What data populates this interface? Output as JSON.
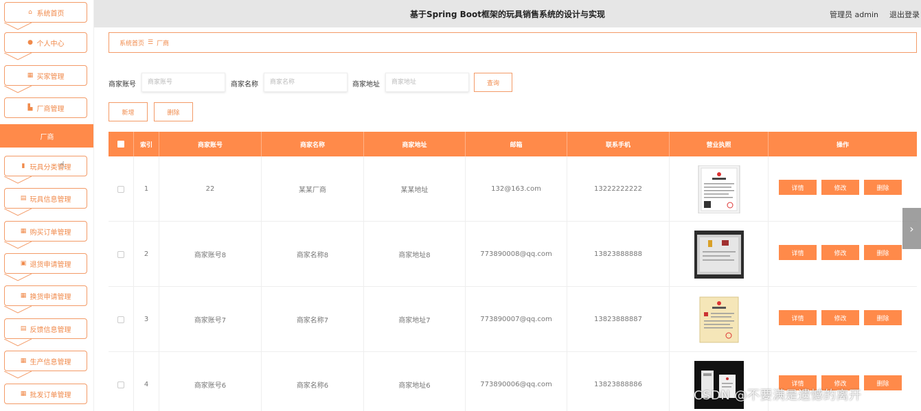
{
  "header": {
    "title": "基于Spring Boot框架的玩具销售系统的设计与实现",
    "user": "管理员 admin",
    "logout": "退出登录"
  },
  "sidebar": {
    "items": [
      {
        "label": "系统首页",
        "icon": "home-icon"
      },
      {
        "label": "个人中心",
        "icon": "user-icon"
      },
      {
        "label": "买家管理",
        "icon": "grid-icon"
      },
      {
        "label": "厂商管理",
        "icon": "factory-icon"
      },
      {
        "label": "厂商",
        "icon": "",
        "active": true
      },
      {
        "label": "玩具分类管理",
        "icon": "chart-icon"
      },
      {
        "label": "玩具信息管理",
        "icon": "clipboard-icon"
      },
      {
        "label": "购买订单管理",
        "icon": "grid-icon"
      },
      {
        "label": "退货申请管理",
        "icon": "doc-icon"
      },
      {
        "label": "换货申请管理",
        "icon": "grid-icon"
      },
      {
        "label": "反馈信息管理",
        "icon": "clipboard-icon"
      },
      {
        "label": "生产信息管理",
        "icon": "grid-icon"
      },
      {
        "label": "批发订单管理",
        "icon": "table-icon"
      }
    ]
  },
  "breadcrumb": {
    "home": "系统首页",
    "separator": "☰",
    "current": "厂商"
  },
  "search": {
    "account_label": "商家账号",
    "account_placeholder": "商家账号",
    "name_label": "商家名称",
    "name_placeholder": "商家名称",
    "address_label": "商家地址",
    "address_placeholder": "商家地址",
    "query_button": "查询"
  },
  "actions": {
    "add_button": "新增",
    "delete_button": "删除"
  },
  "table": {
    "headers": [
      "索引",
      "商家账号",
      "商家名称",
      "商家地址",
      "邮箱",
      "联系手机",
      "营业执照",
      "操作"
    ],
    "rows": [
      {
        "index": "1",
        "account": "22",
        "name": "某某厂商",
        "address": "某某地址",
        "email": "132@163.com",
        "phone": "13222222222"
      },
      {
        "index": "2",
        "account": "商家账号8",
        "name": "商家名称8",
        "address": "商家地址8",
        "email": "773890008@qq.com",
        "phone": "13823888888"
      },
      {
        "index": "3",
        "account": "商家账号7",
        "name": "商家名称7",
        "address": "商家地址7",
        "email": "773890007@qq.com",
        "phone": "13823888887"
      },
      {
        "index": "4",
        "account": "商家账号6",
        "name": "商家名称6",
        "address": "商家地址6",
        "email": "773890006@qq.com",
        "phone": "13823888886"
      }
    ],
    "op_labels": {
      "detail": "详情",
      "edit": "修改",
      "delete": "删除"
    }
  },
  "watermark": "CSDN @不要满是遗憾的离开",
  "colors": {
    "accent": "#ff8a4a",
    "accent_border": "#f39a66",
    "header_bg": "#e6e6e6"
  }
}
